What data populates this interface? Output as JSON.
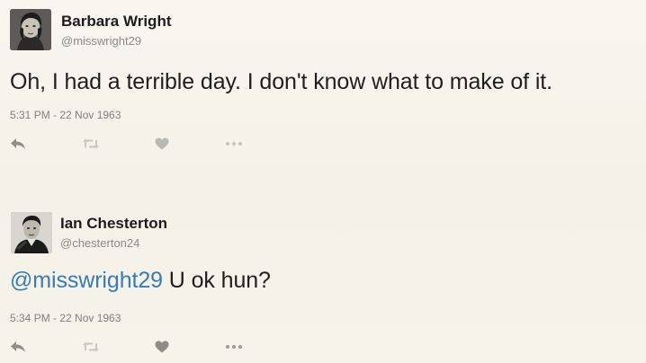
{
  "tweets": [
    {
      "author_name": "Barbara Wright",
      "author_handle": "@misswright29",
      "text": "Oh, I had a terrible day. I don't know what to make of it.",
      "timestamp": "5:31 PM - 22 Nov 1963"
    },
    {
      "author_name": "Ian Chesterton",
      "author_handle": "@chesterton24",
      "mention": "@misswright29",
      "text": " U ok hun?",
      "timestamp": "5:34 PM - 22 Nov 1963"
    }
  ],
  "icons": {
    "reply": "reply-icon",
    "retweet": "retweet-icon",
    "like": "heart-icon",
    "more": "more-icon"
  },
  "colors": {
    "background": "#f6f3ea",
    "mention": "#3a7bb0",
    "icon": "#b9b9b4",
    "icon_dark": "#8f8f8a",
    "secondary_text": "#8a8a8a"
  }
}
